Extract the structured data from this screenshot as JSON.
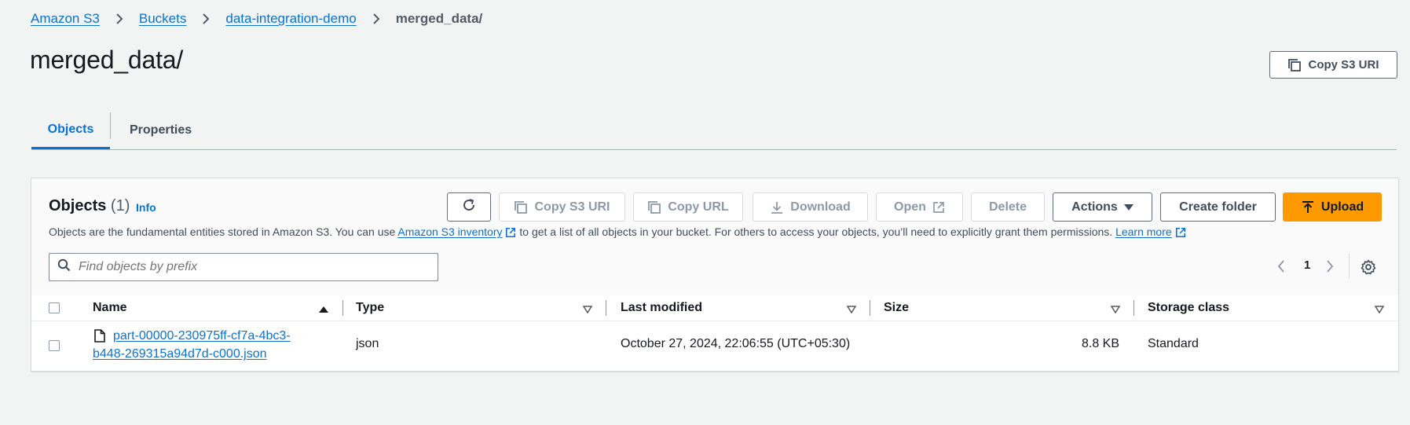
{
  "breadcrumb": {
    "items": [
      "Amazon S3",
      "Buckets",
      "data-integration-demo"
    ],
    "current": "merged_data/"
  },
  "page": {
    "title": "merged_data/",
    "copy_uri_label": "Copy S3 URI"
  },
  "tabs": [
    {
      "label": "Objects",
      "active": true
    },
    {
      "label": "Properties",
      "active": false
    }
  ],
  "objects_panel": {
    "title": "Objects",
    "count": "(1)",
    "info": "Info",
    "description_prefix": "Objects are the fundamental entities stored in Amazon S3. You can use",
    "inventory_link": "Amazon S3 inventory",
    "description_middle": "to get a list of all objects in your bucket. For others to access your objects, you’ll need to explicitly grant them permissions.",
    "learn_more": "Learn more",
    "buttons": {
      "copy_s3_uri": "Copy S3 URI",
      "copy_url": "Copy URL",
      "download": "Download",
      "open": "Open",
      "delete": "Delete",
      "actions": "Actions",
      "create_folder": "Create folder",
      "upload": "Upload"
    },
    "search_placeholder": "Find objects by prefix",
    "current_page": "1"
  },
  "table": {
    "columns": [
      "Name",
      "Type",
      "Last modified",
      "Size",
      "Storage class"
    ],
    "rows": [
      {
        "name_line1": "part-00000-230975ff-cf7a-4bc3-",
        "name_line2": "b448-269315a94d7d-c000.json",
        "type": "json",
        "last_modified": "October 27, 2024, 22:06:55 (UTC+05:30)",
        "size": "8.8 KB",
        "storage_class": "Standard"
      }
    ]
  },
  "colors": {
    "link": "#0972d3",
    "upload_bg": "#ff9900",
    "background": "#f2f3f3"
  }
}
